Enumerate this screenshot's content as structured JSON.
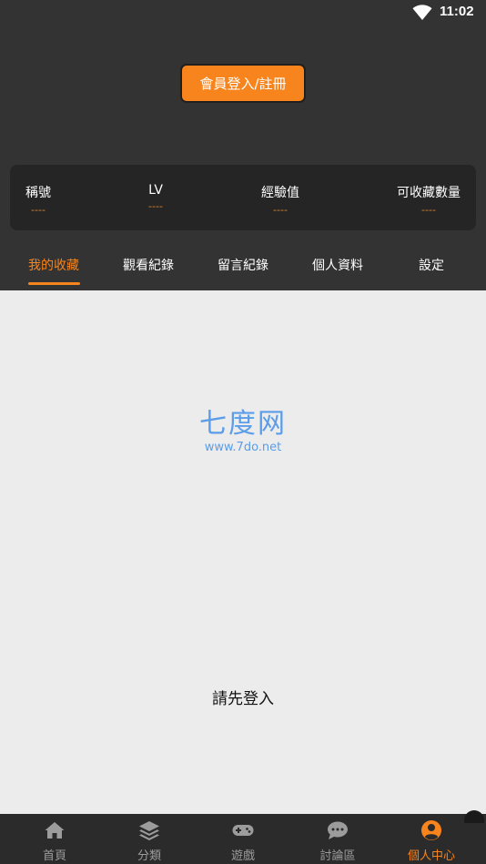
{
  "status_bar": {
    "time": "11:02"
  },
  "login_button_label": "會員登入/註冊",
  "stats": [
    {
      "label": "稱號",
      "value": "----"
    },
    {
      "label": "LV",
      "value": "----"
    },
    {
      "label": "經驗值",
      "value": "----"
    },
    {
      "label": "可收藏數量",
      "value": "----"
    }
  ],
  "tabs": [
    {
      "label": "我的收藏",
      "active": true
    },
    {
      "label": "觀看紀錄",
      "active": false
    },
    {
      "label": "留言紀錄",
      "active": false
    },
    {
      "label": "個人資料",
      "active": false
    },
    {
      "label": "設定",
      "active": false
    }
  ],
  "watermark": {
    "main": "七度网",
    "sub": "www.7do.net"
  },
  "login_prompt": "請先登入",
  "bottom_nav": [
    {
      "label": "首頁",
      "icon": "home-icon",
      "active": false
    },
    {
      "label": "分類",
      "icon": "layers-icon",
      "active": false
    },
    {
      "label": "遊戲",
      "icon": "gamepad-icon",
      "active": false
    },
    {
      "label": "討論區",
      "icon": "chat-icon",
      "active": false
    },
    {
      "label": "個人中心",
      "icon": "user-icon",
      "active": true
    }
  ],
  "colors": {
    "accent": "#f7841c",
    "header_bg": "#333333",
    "card_bg": "#252525",
    "content_bg": "#ececec",
    "nav_bg": "#2b2b2b",
    "nav_inactive": "#9c9c9c"
  }
}
